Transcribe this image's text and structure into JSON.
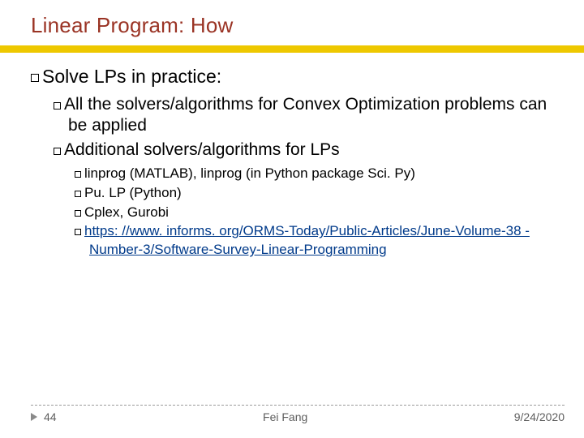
{
  "title": "Linear Program: How",
  "bullets": {
    "l1": "Solve LPs in practice:",
    "l2a": "All the solvers/algorithms for Convex Optimization problems can be applied",
    "l2b": "Additional solvers/algorithms for LPs",
    "l3a": "linprog (MATLAB), linprog (in Python package Sci. Py)",
    "l3b": "Pu. LP (Python)",
    "l3c": "Cplex, Gurobi",
    "l3d_link": "https: //www. informs. org/ORMS-Today/Public-Articles/June-Volume-38 -Number-3/Software-Survey-Linear-Programming"
  },
  "footer": {
    "page": "44",
    "author": "Fei Fang",
    "date": "9/24/2020"
  }
}
